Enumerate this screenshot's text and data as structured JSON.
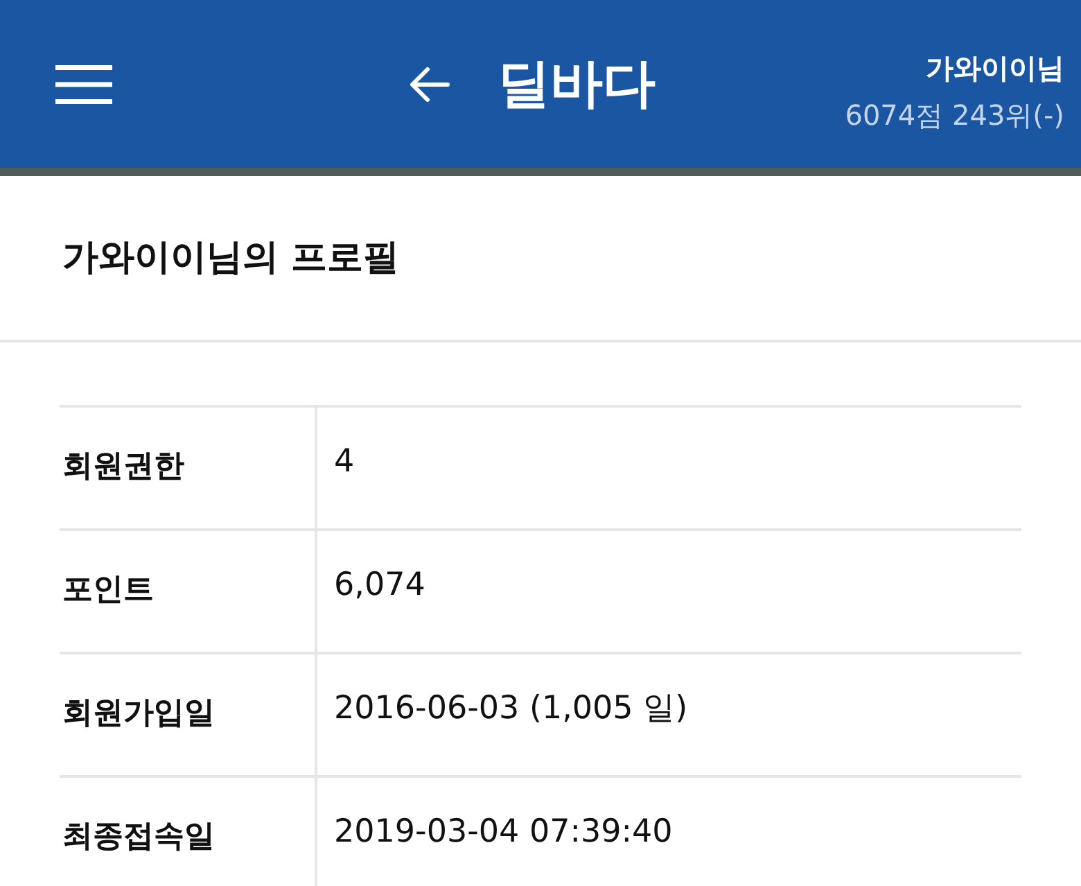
{
  "header": {
    "title": "딜바다",
    "user": {
      "name": "가와이이님",
      "stats": "6074점 243위(-)"
    }
  },
  "profile": {
    "title": "가와이이님의 프로필",
    "rows": [
      {
        "label": "회원권한",
        "value": "4"
      },
      {
        "label": "포인트",
        "value": "6,074"
      },
      {
        "label": "회원가입일",
        "value": "2016-06-03 (1,005 일)"
      },
      {
        "label": "최종접속일",
        "value": "2019-03-04 07:39:40"
      }
    ]
  }
}
